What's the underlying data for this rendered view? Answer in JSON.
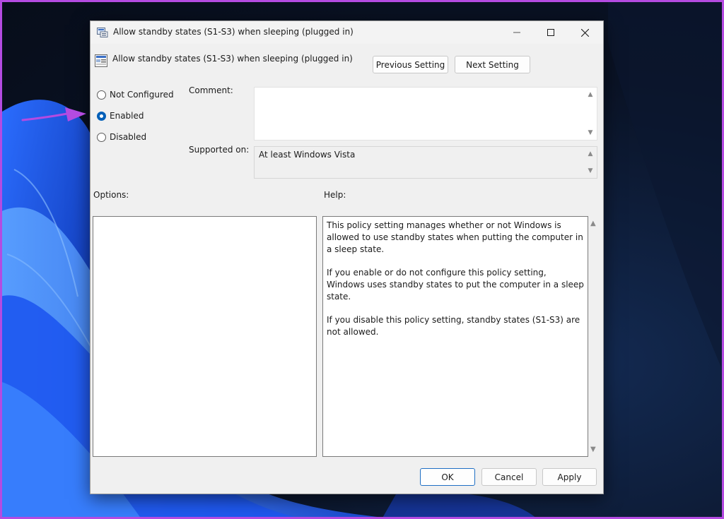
{
  "window": {
    "title": "Allow standby states (S1-S3) when sleeping (plugged in)"
  },
  "header": {
    "policy_title": "Allow standby states (S1-S3) when sleeping (plugged in)",
    "previous_label": "Previous Setting",
    "next_label": "Next Setting"
  },
  "state_options": [
    {
      "label": "Not Configured",
      "selected": false
    },
    {
      "label": "Enabled",
      "selected": true
    },
    {
      "label": "Disabled",
      "selected": false
    }
  ],
  "fields": {
    "comment_label": "Comment:",
    "comment_value": "",
    "supported_label": "Supported on:",
    "supported_value": "At least Windows Vista"
  },
  "sections": {
    "options_label": "Options:",
    "help_label": "Help:"
  },
  "help_text": [
    "This policy setting manages whether or not Windows is allowed to use standby states when putting the computer in a sleep state.",
    "If you enable or do not configure this policy setting, Windows uses standby states to put the computer in a sleep state.",
    "If you disable this policy setting, standby states (S1-S3) are not allowed."
  ],
  "footer": {
    "ok_label": "OK",
    "cancel_label": "Cancel",
    "apply_label": "Apply"
  },
  "icons": {
    "title_icon": "policy-window-icon",
    "heading_icon": "policy-setting-icon",
    "annotation_arrow": "purple-arrow-icon"
  },
  "colors": {
    "accent": "#005fb8",
    "annotation": "#b44be1",
    "dialog_bg": "#f0f0f0"
  }
}
